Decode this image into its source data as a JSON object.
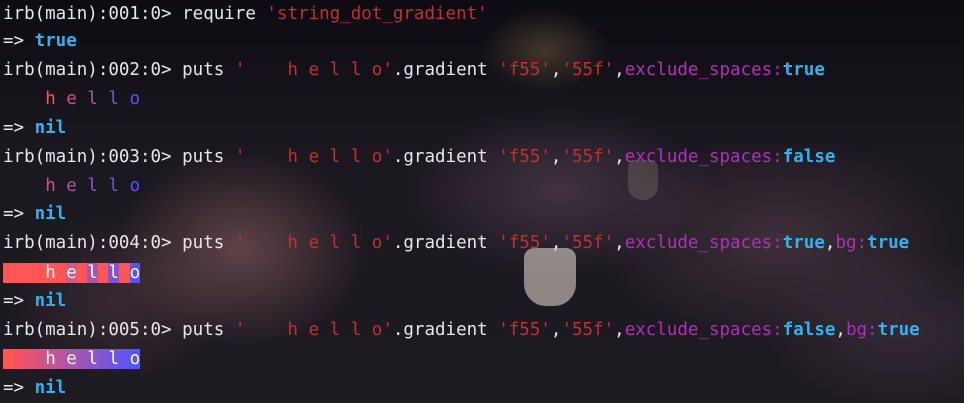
{
  "colors": {
    "prompt": "#e8e6ea",
    "string": "#c23030",
    "symbol": "#b22fbc",
    "boolean": "#2fb3f0",
    "gradient_start": "#ff5555",
    "gradient_end": "#5555ff"
  },
  "lines": [
    {
      "prompt": "irb(main):001:0> ",
      "cmd": "require ",
      "arg": "'string_dot_gradient'"
    },
    {
      "arrow": "=> ",
      "value": "true"
    },
    {
      "prompt": "irb(main):002:0> ",
      "cmd": "puts ",
      "str": "'    h e l l o'",
      "method": ".gradient ",
      "a1": "'f55'",
      "comma": ",",
      "a2": "'55f'",
      "comma2": ",",
      "key": "exclude_spaces:",
      "val": "true"
    },
    {
      "output": "    h e l l o"
    },
    {
      "arrow": "=> ",
      "value": "nil"
    },
    {
      "prompt": "irb(main):003:0> ",
      "cmd": "puts ",
      "str": "'    h e l l o'",
      "method": ".gradient ",
      "a1": "'f55'",
      "comma": ",",
      "a2": "'55f'",
      "comma2": ",",
      "key": "exclude_spaces:",
      "val": "false"
    },
    {
      "output": "    h e l l o"
    },
    {
      "arrow": "=> ",
      "value": "nil"
    },
    {
      "prompt": "irb(main):004:0> ",
      "cmd": "puts ",
      "str": "'    h e l l o'",
      "method": ".gradient ",
      "a1": "'f55'",
      "comma": ",",
      "a2": "'55f'",
      "comma2": ",",
      "key": "exclude_spaces:",
      "val": "true",
      "comma3": ",",
      "key2": "bg:",
      "val2": "true"
    },
    {
      "output": "    h e l l o"
    },
    {
      "arrow": "=> ",
      "value": "nil"
    },
    {
      "prompt": "irb(main):005:0> ",
      "cmd": "puts ",
      "str": "'    h e l l o'",
      "method": ".gradient ",
      "a1": "'f55'",
      "comma": ",",
      "a2": "'55f'",
      "comma2": ",",
      "key": "exclude_spaces:",
      "val": "false",
      "comma3": ",",
      "key2": "bg:",
      "val2": "true"
    },
    {
      "output": "    h e l l o"
    },
    {
      "arrow": "=> ",
      "value": "nil"
    }
  ]
}
